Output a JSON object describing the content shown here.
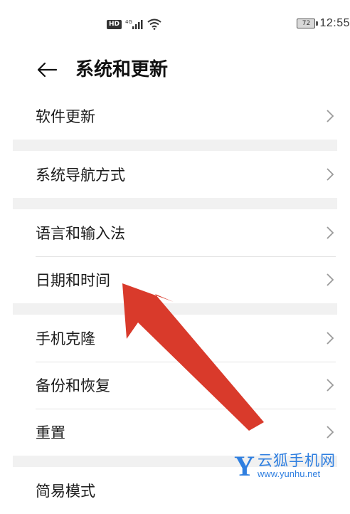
{
  "status_bar": {
    "hd_label": "HD",
    "network_label": "4G",
    "battery_level": "72",
    "time": "12:55"
  },
  "header": {
    "title": "系统和更新"
  },
  "groups": [
    {
      "items": [
        {
          "label": "软件更新"
        }
      ]
    },
    {
      "items": [
        {
          "label": "系统导航方式"
        }
      ]
    },
    {
      "items": [
        {
          "label": "语言和输入法"
        },
        {
          "label": "日期和时间"
        }
      ]
    },
    {
      "items": [
        {
          "label": "手机克隆"
        },
        {
          "label": "备份和恢复"
        },
        {
          "label": "重置"
        }
      ]
    },
    {
      "items": [
        {
          "label": "简易模式"
        }
      ]
    }
  ],
  "annotation": {
    "arrow_color": "#d93a2b",
    "points_to": "日期和时间"
  },
  "watermark": {
    "logo_letter": "Y",
    "name": "云狐手机网",
    "url": "www.yunhu.net",
    "color": "#2f7fe0"
  }
}
